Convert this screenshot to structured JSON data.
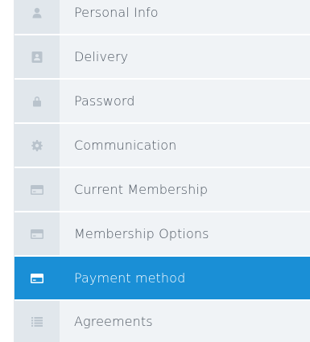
{
  "menu": {
    "items": [
      {
        "label": "Personal Info",
        "icon": "user-icon",
        "active": false
      },
      {
        "label": "Delivery",
        "icon": "address-card-icon",
        "active": false
      },
      {
        "label": "Password",
        "icon": "lock-icon",
        "active": false
      },
      {
        "label": "Communication",
        "icon": "gear-icon",
        "active": false
      },
      {
        "label": "Current Membership",
        "icon": "credit-card-icon",
        "active": false
      },
      {
        "label": "Membership Options",
        "icon": "credit-card-icon",
        "active": false
      },
      {
        "label": "Payment method",
        "icon": "credit-card-icon",
        "active": true
      },
      {
        "label": "Agreements",
        "icon": "list-icon",
        "active": false
      }
    ]
  },
  "colors": {
    "active_bg": "#1a8fd6",
    "item_bg": "#f0f3f6",
    "icon_cell_bg": "#e1e7ec",
    "icon_color": "#b9c3cc",
    "text_color": "#4c5560"
  }
}
